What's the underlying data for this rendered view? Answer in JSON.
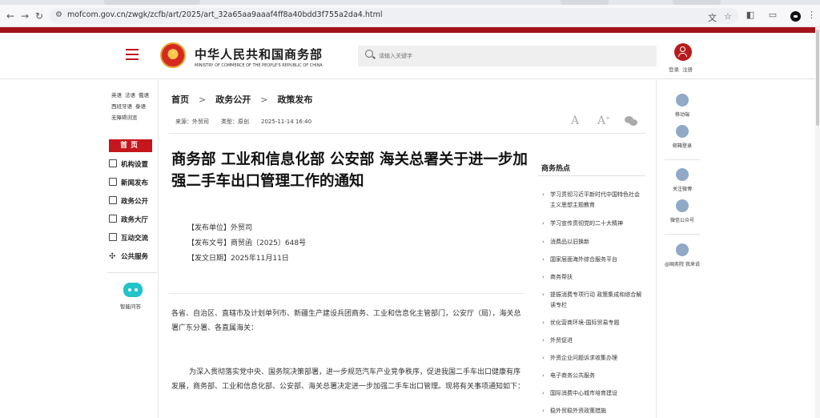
{
  "browser": {
    "url": "mofcom.gov.cn/zwgk/zcfb/art/2025/art_32a65aa9aaaf4ff8a40bdd3f755a2da4.html"
  },
  "header": {
    "site_name": "中华人民共和国商务部",
    "site_name_en": "MINISTRY OF COMMERCE OF THE PEOPLE'S REPUBLIC OF CHINA",
    "search_placeholder": "请输入关键字",
    "login_label": "登录",
    "register_label": "注册"
  },
  "sidebar": {
    "languages": [
      [
        "英语",
        "法语",
        "俄语"
      ],
      [
        "西班牙语",
        "泰语"
      ],
      [
        "无障碍浏览"
      ]
    ],
    "home_label": "首页",
    "items": [
      {
        "label": "机构设置",
        "icon": "grid-icon"
      },
      {
        "label": "新闻发布",
        "icon": "news-icon"
      },
      {
        "label": "政务公开",
        "icon": "document-icon"
      },
      {
        "label": "政务大厅",
        "icon": "monitor-icon"
      },
      {
        "label": "互动交流",
        "icon": "chat-icon"
      },
      {
        "label": "公共服务",
        "icon": "service-icon"
      }
    ],
    "assistant_label": "智能问答"
  },
  "breadcrumb": [
    "首页",
    "政务公开",
    "政策发布"
  ],
  "meta": {
    "source": "来源：外贸司",
    "type": "类型：原创",
    "datetime": "2025-11-14 16:40"
  },
  "article": {
    "title": "商务部 工业和信息化部 公安部 海关总署关于进一步加强二手车出口管理工作的通知",
    "issuer": "【发布单位】外贸司",
    "doc_no": "【发布文号】商贸函〔2025〕648号",
    "issue_date": "【发文日期】2025年11月11日",
    "addressee": "各省、自治区、直辖市及计划单列市、新疆生产建设兵团商务、工业和信息化主管部门，公安厅（局），海关总署广东分署、各直属海关：",
    "intro": "为深入贯彻落实党中央、国务院决策部署，进一步规范汽车产业竞争秩序，促进我国二手车出口健康有序发展，商务部、工业和信息化部、公安部、海关总署决定进一步加强二手车出口管理。现将有关事项通知如下："
  },
  "hot_topics": {
    "title": "商务热点",
    "items": [
      "学习贯彻习近平新时代中国特色社会主义思想主题教育",
      "学习宣传贯彻党的二十大精神",
      "消费品以旧换新",
      "国家层面海外综合服务平台",
      "商务帮扶",
      "提振消费专项行动 政策集成和综合解读专栏",
      "优化营商环境-国际贸易专题",
      "外贸促进",
      "外资企业问题诉求收集办理",
      "电子商务公共服务",
      "国际消费中心城市培育建设",
      "稳外贸稳外资政策措施"
    ]
  },
  "right_sidebar": [
    {
      "label": "移动端",
      "icon": "mobile-icon"
    },
    {
      "label": "邮箱登录",
      "icon": "mail-icon"
    },
    {
      "label": "关注微博",
      "icon": "weibo-icon"
    },
    {
      "label": "微信公众号",
      "icon": "wechat-icon"
    },
    {
      "label": "@国务院 我来说",
      "icon": "at-icon"
    }
  ],
  "colors": {
    "brand_red": "#a4131b",
    "home_button": "#c4161c",
    "assistant": "#22c3c9"
  }
}
